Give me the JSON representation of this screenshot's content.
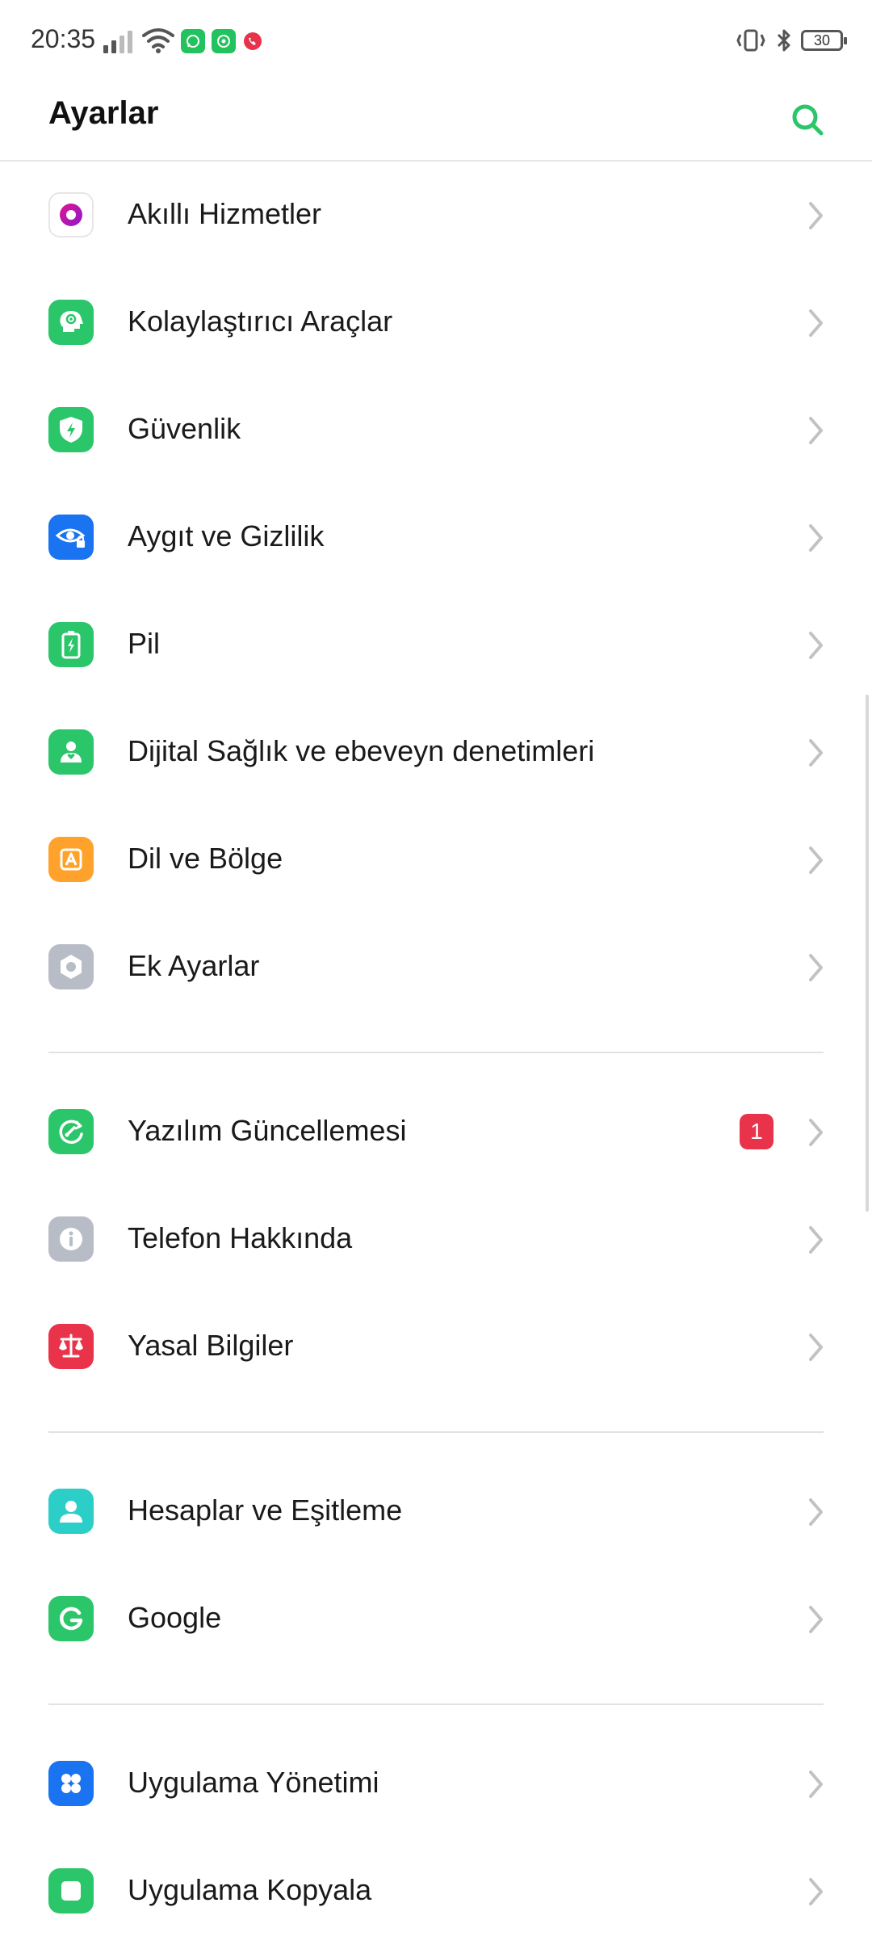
{
  "status": {
    "time": "20:35",
    "battery": "30"
  },
  "header": {
    "title": "Ayarlar"
  },
  "colors": {
    "accent": "#2bc56a",
    "badge": "#e8334a"
  },
  "settings": {
    "items": [
      {
        "label": "Akıllı Hizmetler",
        "icon": "smart-services-icon"
      },
      {
        "label": "Kolaylaştırıcı Araçlar",
        "icon": "accessibility-icon"
      },
      {
        "label": "Güvenlik",
        "icon": "shield-icon"
      },
      {
        "label": "Aygıt ve Gizlilik",
        "icon": "privacy-eye-icon"
      },
      {
        "label": "Pil",
        "icon": "battery-icon"
      },
      {
        "label": "Dijital Sağlık ve ebeveyn denetimleri",
        "icon": "digital-wellbeing-icon"
      },
      {
        "label": "Dil ve Bölge",
        "icon": "language-icon"
      },
      {
        "label": "Ek Ayarlar",
        "icon": "gear-icon"
      },
      {
        "label": "Yazılım Güncellemesi",
        "icon": "update-icon",
        "badge": "1"
      },
      {
        "label": "Telefon Hakkında",
        "icon": "info-icon"
      },
      {
        "label": "Yasal Bilgiler",
        "icon": "scales-icon"
      },
      {
        "label": "Hesaplar ve Eşitleme",
        "icon": "account-icon"
      },
      {
        "label": "Google",
        "icon": "google-icon"
      },
      {
        "label": "Uygulama Yönetimi",
        "icon": "apps-icon"
      },
      {
        "label": "Uygulama Kopyala",
        "icon": "app-clone-icon"
      }
    ]
  }
}
